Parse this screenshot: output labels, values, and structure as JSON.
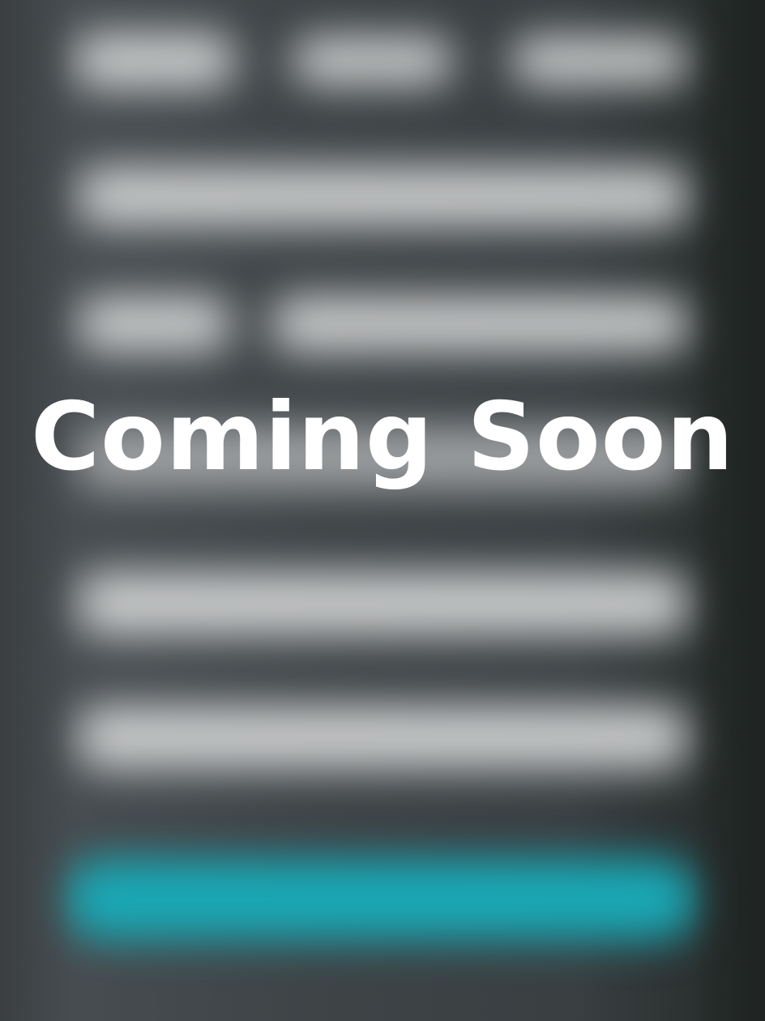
{
  "overlay": {
    "headline": "Coming Soon"
  },
  "colors": {
    "background": "#3f4447",
    "placeholder_bar": "#c8cacb",
    "accent_button": "#19a9b6",
    "headline_text": "#ffffff"
  }
}
